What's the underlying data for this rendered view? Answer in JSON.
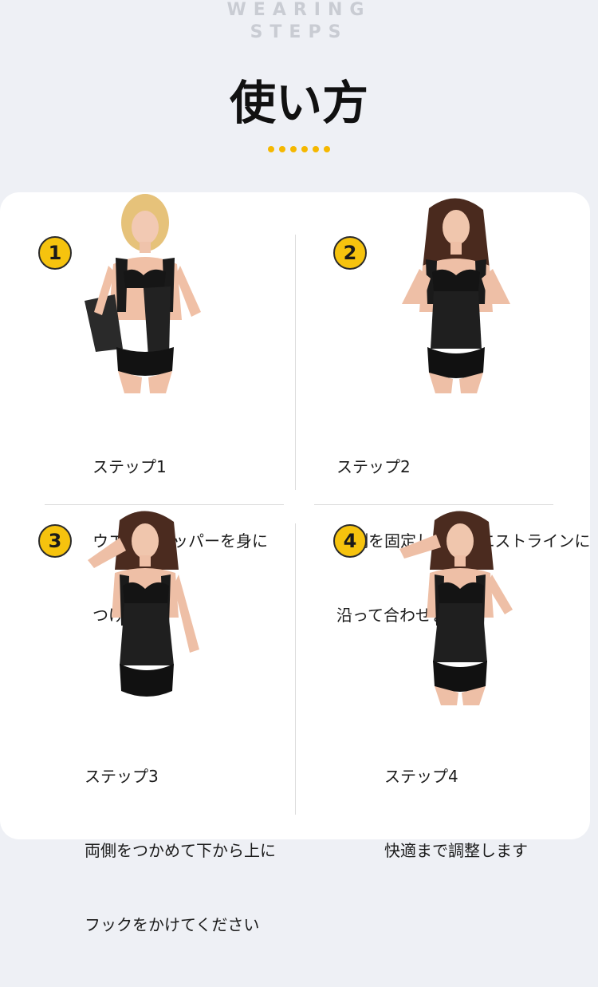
{
  "header": {
    "eyebrow_line1": "WEARING",
    "eyebrow_line2": "STEPS",
    "title": "使い方",
    "dot_color": "#f5b800"
  },
  "steps": [
    {
      "number": "1",
      "heading": "ステップ1",
      "lines": [
        "ウエストニッパーを身に",
        "つけます"
      ]
    },
    {
      "number": "2",
      "heading": "ステップ2",
      "lines": [
        "片側を固定して、ウエストラインに",
        "沿って合わせます"
      ]
    },
    {
      "number": "3",
      "heading": "ステップ3",
      "lines": [
        "両側をつかめて下から上に",
        "フックをかけてください"
      ]
    },
    {
      "number": "4",
      "heading": "ステップ4",
      "lines": [
        "快適まで調整します"
      ]
    }
  ]
}
